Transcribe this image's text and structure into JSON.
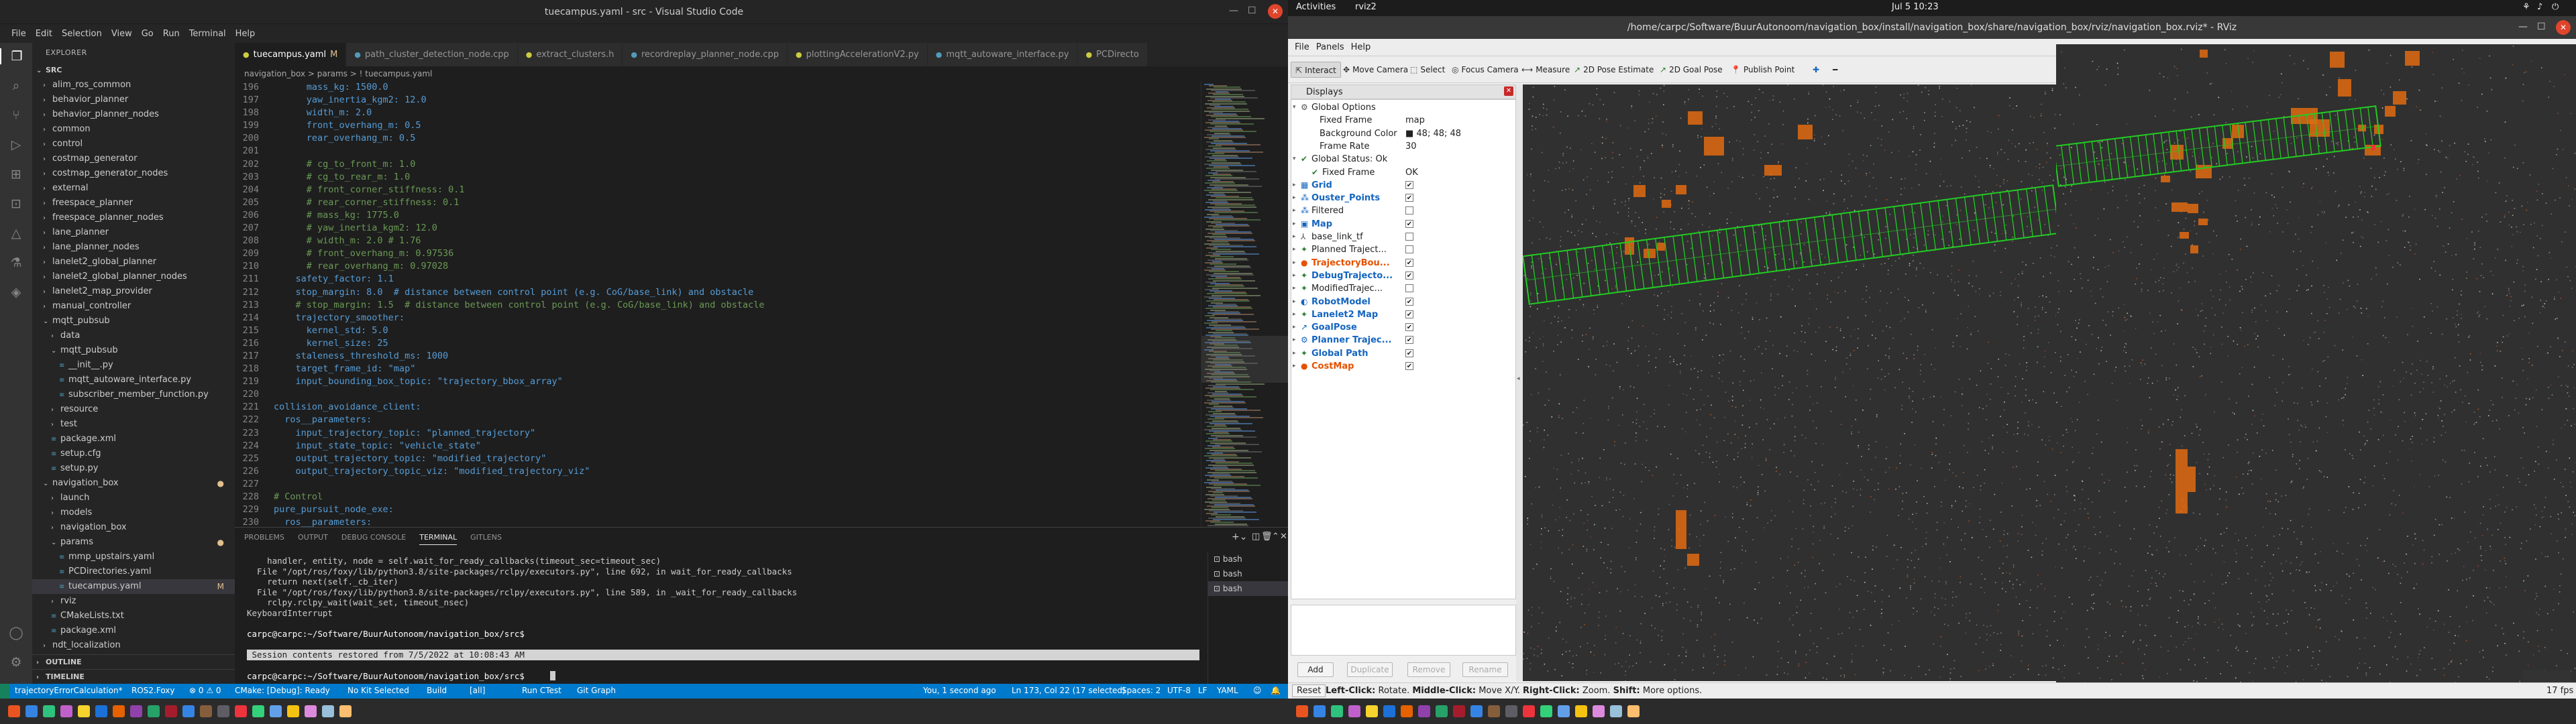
{
  "vscode": {
    "title": "tuecampus.yaml - src - Visual Studio Code",
    "menu": [
      "File",
      "Edit",
      "Selection",
      "View",
      "Go",
      "Run",
      "Terminal",
      "Help"
    ],
    "explorer": {
      "header": "EXPLORER",
      "root": "SRC",
      "items": [
        {
          "label": "alim_ros_common",
          "indent": 1,
          "folder": true
        },
        {
          "label": "behavior_planner",
          "indent": 1,
          "folder": true
        },
        {
          "label": "behavior_planner_nodes",
          "indent": 1,
          "folder": true
        },
        {
          "label": "common",
          "indent": 1,
          "folder": true
        },
        {
          "label": "control",
          "indent": 1,
          "folder": true
        },
        {
          "label": "costmap_generator",
          "indent": 1,
          "folder": true
        },
        {
          "label": "costmap_generator_nodes",
          "indent": 1,
          "folder": true
        },
        {
          "label": "external",
          "indent": 1,
          "folder": true
        },
        {
          "label": "freespace_planner",
          "indent": 1,
          "folder": true
        },
        {
          "label": "freespace_planner_nodes",
          "indent": 1,
          "folder": true
        },
        {
          "label": "lane_planner",
          "indent": 1,
          "folder": true
        },
        {
          "label": "lane_planner_nodes",
          "indent": 1,
          "folder": true
        },
        {
          "label": "lanelet2_global_planner",
          "indent": 1,
          "folder": true
        },
        {
          "label": "lanelet2_global_planner_nodes",
          "indent": 1,
          "folder": true
        },
        {
          "label": "lanelet2_map_provider",
          "indent": 1,
          "folder": true
        },
        {
          "label": "manual_controller",
          "indent": 1,
          "folder": true
        },
        {
          "label": "mqtt_pubsub",
          "indent": 1,
          "folder": true,
          "open": true
        },
        {
          "label": "data",
          "indent": 2,
          "folder": true
        },
        {
          "label": "mqtt_pubsub",
          "indent": 2,
          "folder": true,
          "open": true
        },
        {
          "label": "__init__.py",
          "indent": 3,
          "folder": false
        },
        {
          "label": "mqtt_autoware_interface.py",
          "indent": 3,
          "folder": false
        },
        {
          "label": "subscriber_member_function.py",
          "indent": 3,
          "folder": false
        },
        {
          "label": "resource",
          "indent": 2,
          "folder": true
        },
        {
          "label": "test",
          "indent": 2,
          "folder": true
        },
        {
          "label": "package.xml",
          "indent": 2,
          "folder": false
        },
        {
          "label": "setup.cfg",
          "indent": 2,
          "folder": false
        },
        {
          "label": "setup.py",
          "indent": 2,
          "folder": false
        },
        {
          "label": "navigation_box",
          "indent": 1,
          "folder": true,
          "open": true,
          "badge": "●"
        },
        {
          "label": "launch",
          "indent": 2,
          "folder": true
        },
        {
          "label": "models",
          "indent": 2,
          "folder": true
        },
        {
          "label": "navigation_box",
          "indent": 2,
          "folder": true
        },
        {
          "label": "params",
          "indent": 2,
          "folder": true,
          "open": true,
          "badge": "●"
        },
        {
          "label": "mmp_upstairs.yaml",
          "indent": 3,
          "folder": false
        },
        {
          "label": "PCDirectories.yaml",
          "indent": 3,
          "folder": false
        },
        {
          "label": "tuecampus.yaml",
          "indent": 3,
          "folder": false,
          "active": true,
          "badge": "M"
        },
        {
          "label": "rviz",
          "indent": 2,
          "folder": true
        },
        {
          "label": "CMakeLists.txt",
          "indent": 2,
          "folder": false
        },
        {
          "label": "package.xml",
          "indent": 2,
          "folder": false
        },
        {
          "label": "ndt_localization",
          "indent": 1,
          "folder": true
        }
      ],
      "outline": "OUTLINE",
      "timeline": "TIMELINE"
    },
    "tabs": [
      {
        "label": "tuecampus.yaml",
        "suffix": "M",
        "active": true
      },
      {
        "label": "path_cluster_detection_node.cpp"
      },
      {
        "label": "extract_clusters.h"
      },
      {
        "label": "recordreplay_planner_node.cpp"
      },
      {
        "label": "plottingAccelerationV2.py"
      },
      {
        "label": "mqtt_autoware_interface.py"
      },
      {
        "label": "PCDirecto"
      }
    ],
    "breadcrumb": "navigation_box > params > ! tuecampus.yaml",
    "code": [
      {
        "n": "196",
        "t": "      mass_kg: 1500.0",
        "cls": "kv"
      },
      {
        "n": "197",
        "t": "      yaw_inertia_kgm2: 12.0",
        "cls": "kv"
      },
      {
        "n": "198",
        "t": "      width_m: 2.0",
        "cls": "kv"
      },
      {
        "n": "199",
        "t": "      front_overhang_m: 0.5",
        "cls": "kv"
      },
      {
        "n": "200",
        "t": "      rear_overhang_m: 0.5",
        "cls": "kv"
      },
      {
        "n": "201",
        "t": "",
        "cls": "p"
      },
      {
        "n": "202",
        "t": "      # cg_to_front_m: 1.0",
        "cls": "c"
      },
      {
        "n": "203",
        "t": "      # cg_to_rear_m: 1.0",
        "cls": "c"
      },
      {
        "n": "204",
        "t": "      # front_corner_stiffness: 0.1",
        "cls": "c"
      },
      {
        "n": "205",
        "t": "      # rear_corner_stiffness: 0.1",
        "cls": "c"
      },
      {
        "n": "206",
        "t": "      # mass_kg: 1775.0",
        "cls": "c"
      },
      {
        "n": "207",
        "t": "      # yaw_inertia_kgm2: 12.0",
        "cls": "c"
      },
      {
        "n": "208",
        "t": "      # width_m: 2.0 # 1.76",
        "cls": "c"
      },
      {
        "n": "209",
        "t": "      # front_overhang_m: 0.97536",
        "cls": "c"
      },
      {
        "n": "210",
        "t": "      # rear_overhang_m: 0.97028",
        "cls": "c"
      },
      {
        "n": "211",
        "t": "    safety_factor: 1.1",
        "cls": "kv"
      },
      {
        "n": "212",
        "t": "    stop_margin: 8.0  # distance between control point (e.g. CoG/base_link) and obstacle",
        "cls": "kvc"
      },
      {
        "n": "213",
        "t": "    # stop_margin: 1.5  # distance between control point (e.g. CoG/base_link) and obstacle",
        "cls": "c"
      },
      {
        "n": "214",
        "t": "    trajectory_smoother:",
        "cls": "k"
      },
      {
        "n": "215",
        "t": "      kernel_std: 5.0",
        "cls": "kv"
      },
      {
        "n": "216",
        "t": "      kernel_size: 25",
        "cls": "kv"
      },
      {
        "n": "217",
        "t": "    staleness_threshold_ms: 1000",
        "cls": "kv"
      },
      {
        "n": "218",
        "t": "    target_frame_id: \"map\"",
        "cls": "kv"
      },
      {
        "n": "219",
        "t": "    input_bounding_box_topic: \"trajectory_bbox_array\"",
        "cls": "kv"
      },
      {
        "n": "220",
        "t": "",
        "cls": "p"
      },
      {
        "n": "221",
        "t": "collision_avoidance_client:",
        "cls": "k"
      },
      {
        "n": "222",
        "t": "  ros__parameters:",
        "cls": "k"
      },
      {
        "n": "223",
        "t": "    input_trajectory_topic: \"planned_trajectory\"",
        "cls": "kv"
      },
      {
        "n": "224",
        "t": "    input_state_topic: \"vehicle_state\"",
        "cls": "kv"
      },
      {
        "n": "225",
        "t": "    output_trajectory_topic: \"modified_trajectory\"",
        "cls": "kv"
      },
      {
        "n": "226",
        "t": "    output_trajectory_topic_viz: \"modified_trajectory_viz\"",
        "cls": "kv"
      },
      {
        "n": "227",
        "t": "",
        "cls": "p"
      },
      {
        "n": "228",
        "t": "# Control",
        "cls": "c"
      },
      {
        "n": "229",
        "t": "pure_pursuit_node_exe:",
        "cls": "k"
      },
      {
        "n": "230",
        "t": "  ros__parameters:",
        "cls": "k"
      }
    ],
    "panel_tabs": [
      "PROBLEMS",
      "OUTPUT",
      "DEBUG CONSOLE",
      "TERMINAL",
      "GITLENS"
    ],
    "panel_active": "TERMINAL",
    "terminal": [
      "    handler, entity, node = self.wait_for_ready_callbacks(timeout_sec=timeout_sec)",
      "  File \"/opt/ros/foxy/lib/python3.8/site-packages/rclpy/executors.py\", line 692, in wait_for_ready_callbacks",
      "    return next(self._cb_iter)",
      "  File \"/opt/ros/foxy/lib/python3.8/site-packages/rclpy/executors.py\", line 589, in _wait_for_ready_callbacks",
      "    rclpy.rclpy_wait(wait_set, timeout_nsec)",
      "KeyboardInterrupt",
      "",
      "carpc@carpc:~/Software/BuurAutonoom/navigation_box/src$ ",
      "",
      " Session contents restored from 7/5/2022 at 10:08:43 AM ",
      "",
      "carpc@carpc:~/Software/BuurAutonoom/navigation_box/src$ "
    ],
    "terminal_list": [
      "bash",
      "bash",
      "bash"
    ],
    "status": {
      "branch": "trajectoryErrorCalculation*",
      "ros": "ROS2.Foxy",
      "problems": "⊗ 0 ⚠ 0",
      "cmake": "CMake: [Debug]: Ready",
      "kit": "No Kit Selected",
      "build": "Build",
      "all": "[all]",
      "ctest": "Run CTest",
      "git_graph": "Git Graph",
      "blame": "You, 1 second ago",
      "position": "Ln 173, Col 22 (17 selected)",
      "spaces": "Spaces: 2",
      "encoding": "UTF-8",
      "eol": "LF",
      "lang": "YAML"
    }
  },
  "rviz": {
    "activities": "Activities",
    "app_menu": "rviz2",
    "clock": "Jul 5  10:23",
    "title": "/home/carpc/Software/BuurAutonoom/navigation_box/install/navigation_box/share/navigation_box/rviz/navigation_box.rviz* - RViz",
    "menu": [
      "File",
      "Panels",
      "Help"
    ],
    "tools": [
      "Interact",
      "Move Camera",
      "Select",
      "Focus Camera",
      "Measure",
      "2D Pose Estimate",
      "2D Goal Pose",
      "Publish Point"
    ],
    "displays_header": "Displays",
    "displays": [
      {
        "label": "Global Options",
        "indent": 0,
        "icon": "⚙",
        "color": "#555"
      },
      {
        "label": "Fixed Frame",
        "indent": 1,
        "value": "map"
      },
      {
        "label": "Background Color",
        "indent": 1,
        "value": "■ 48; 48; 48"
      },
      {
        "label": "Frame Rate",
        "indent": 1,
        "value": "30"
      },
      {
        "label": "Global Status: Ok",
        "indent": 0,
        "icon": "✔",
        "color": "#2e7d32"
      },
      {
        "label": "Fixed Frame",
        "indent": 1,
        "value": "OK",
        "icon": "✔",
        "color": "#2e7d32"
      },
      {
        "label": "Grid",
        "indent": 0,
        "check": "✔",
        "style": "blue",
        "icon": "▦",
        "color": "#1565c0"
      },
      {
        "label": "Ouster_Points",
        "indent": 0,
        "check": "✔",
        "style": "blue",
        "icon": "⁂",
        "color": "#1565c0"
      },
      {
        "label": "Filtered",
        "indent": 0,
        "check": "",
        "icon": "⁂",
        "color": "#1565c0"
      },
      {
        "label": "Map",
        "indent": 0,
        "check": "✔",
        "style": "blue",
        "icon": "▣",
        "color": "#1565c0"
      },
      {
        "label": "base_link_tf",
        "indent": 0,
        "check": "",
        "icon": "⅄",
        "color": "#555"
      },
      {
        "label": "Planned Traject...",
        "indent": 0,
        "check": "",
        "icon": "✦",
        "color": "#2e7d32"
      },
      {
        "label": "TrajectoryBou...",
        "indent": 0,
        "check": "✔",
        "style": "orange",
        "icon": "●",
        "color": "#e65100"
      },
      {
        "label": "DebugTrajecto...",
        "indent": 0,
        "check": "✔",
        "style": "blue",
        "icon": "✦",
        "color": "#2e7d32"
      },
      {
        "label": "ModifiedTrajec...",
        "indent": 0,
        "check": "",
        "icon": "✦",
        "color": "#2e7d32"
      },
      {
        "label": "RobotModel",
        "indent": 0,
        "check": "✔",
        "style": "blue",
        "icon": "◐",
        "color": "#1565c0"
      },
      {
        "label": "Lanelet2 Map",
        "indent": 0,
        "check": "✔",
        "style": "blue",
        "icon": "✦",
        "color": "#2e7d32"
      },
      {
        "label": "GoalPose",
        "indent": 0,
        "check": "✔",
        "style": "blue",
        "icon": "↗",
        "color": "#1565c0"
      },
      {
        "label": "Planner Trajec...",
        "indent": 0,
        "check": "✔",
        "style": "blue",
        "icon": "⚙",
        "color": "#1565c0"
      },
      {
        "label": "Global Path",
        "indent": 0,
        "check": "✔",
        "style": "blue",
        "icon": "✦",
        "color": "#2e7d32"
      },
      {
        "label": "CostMap",
        "indent": 0,
        "check": "✔",
        "style": "orange",
        "icon": "●",
        "color": "#e65100"
      }
    ],
    "buttons": [
      "Add",
      "Duplicate",
      "Remove",
      "Rename"
    ],
    "status": {
      "reset": "Reset",
      "help_left": "Left-Click:",
      "help_left_t": "Rotate.",
      "help_mid": "Middle-Click:",
      "help_mid_t": "Move X/Y.",
      "help_right": "Right-Click:",
      "help_right_t": "Zoom.",
      "help_shift": "Shift:",
      "help_shift_t": "More options.",
      "fps": "17 fps"
    }
  },
  "colors": {
    "vscode_bg": "#1e1e1e",
    "status_blue": "#007acc",
    "trajectory_green": "#22cc22",
    "costmap_orange": "#e06a10"
  }
}
